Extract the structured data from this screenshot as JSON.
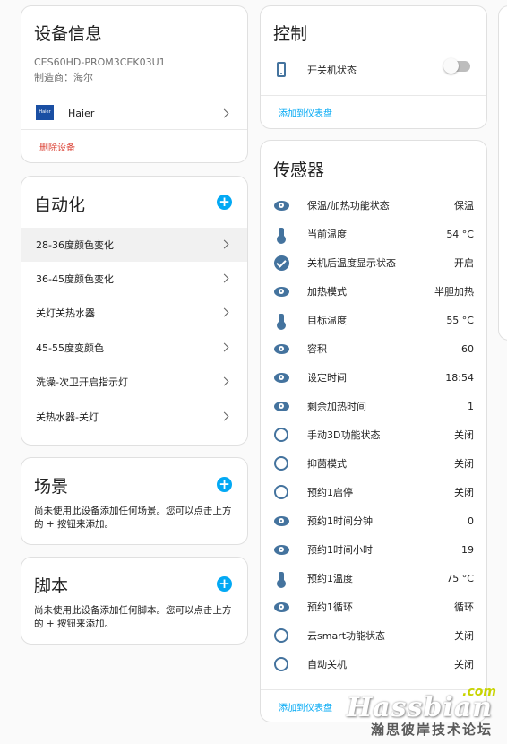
{
  "device_info": {
    "title": "设备信息",
    "model": "CES60HD-PROM3CEK03U1",
    "manufacturer": "制造商：海尔",
    "brand_link": "Haier",
    "brand_logo_text": "Haier",
    "delete_label": "删除设备"
  },
  "automation": {
    "title": "自动化",
    "items": [
      {
        "label": "28-36度颜色变化"
      },
      {
        "label": "36-45度颜色变化"
      },
      {
        "label": "关灯关热水器"
      },
      {
        "label": "45-55度变颜色"
      },
      {
        "label": "洗澡-次卫开启指示灯"
      },
      {
        "label": "关热水器-关灯"
      }
    ]
  },
  "scene": {
    "title": "场景",
    "description": "尚未使用此设备添加任何场景。您可以点击上方的 + 按钮来添加。"
  },
  "script": {
    "title": "脚本",
    "description": "尚未使用此设备添加任何脚本。您可以点击上方的 + 按钮来添加。"
  },
  "control": {
    "title": "控制",
    "switch_label": "开关机状态",
    "switch_on": false,
    "add_to_dashboard": "添加到仪表盘"
  },
  "sensors": {
    "title": "传感器",
    "add_to_dashboard": "添加到仪表盘",
    "items": [
      {
        "icon": "eye-icon",
        "label": "保温/加热功能状态",
        "value": "保温"
      },
      {
        "icon": "thermometer-icon",
        "label": "当前温度",
        "value": "54 °C"
      },
      {
        "icon": "check-circle-icon",
        "label": "关机后温度显示状态",
        "value": "开启"
      },
      {
        "icon": "eye-icon",
        "label": "加热模式",
        "value": "半胆加热"
      },
      {
        "icon": "thermometer-icon",
        "label": "目标温度",
        "value": "55 °C"
      },
      {
        "icon": "eye-icon",
        "label": "容积",
        "value": "60"
      },
      {
        "icon": "eye-icon",
        "label": "设定时间",
        "value": "18:54"
      },
      {
        "icon": "eye-icon",
        "label": "剩余加热时间",
        "value": "1"
      },
      {
        "icon": "circle-outline-icon",
        "label": "手动3D功能状态",
        "value": "关闭"
      },
      {
        "icon": "circle-outline-icon",
        "label": "抑菌模式",
        "value": "关闭"
      },
      {
        "icon": "circle-outline-icon",
        "label": "预约1启停",
        "value": "关闭"
      },
      {
        "icon": "eye-icon",
        "label": "预约1时间分钟",
        "value": "0"
      },
      {
        "icon": "eye-icon",
        "label": "预约1时间小时",
        "value": "19"
      },
      {
        "icon": "thermometer-icon",
        "label": "预约1温度",
        "value": "75 °C"
      },
      {
        "icon": "eye-icon",
        "label": "预约1循环",
        "value": "循环"
      },
      {
        "icon": "circle-outline-icon",
        "label": "云smart功能状态",
        "value": "关闭"
      },
      {
        "icon": "circle-outline-icon",
        "label": "自动关机",
        "value": "关闭"
      }
    ]
  },
  "watermark": {
    "brand": "Hassbian",
    "domain": ".com",
    "subtitle": "瀚思彼岸技术论坛"
  },
  "colors": {
    "accent": "#03a9f4",
    "icon": "#44739e",
    "danger": "#db4437"
  }
}
